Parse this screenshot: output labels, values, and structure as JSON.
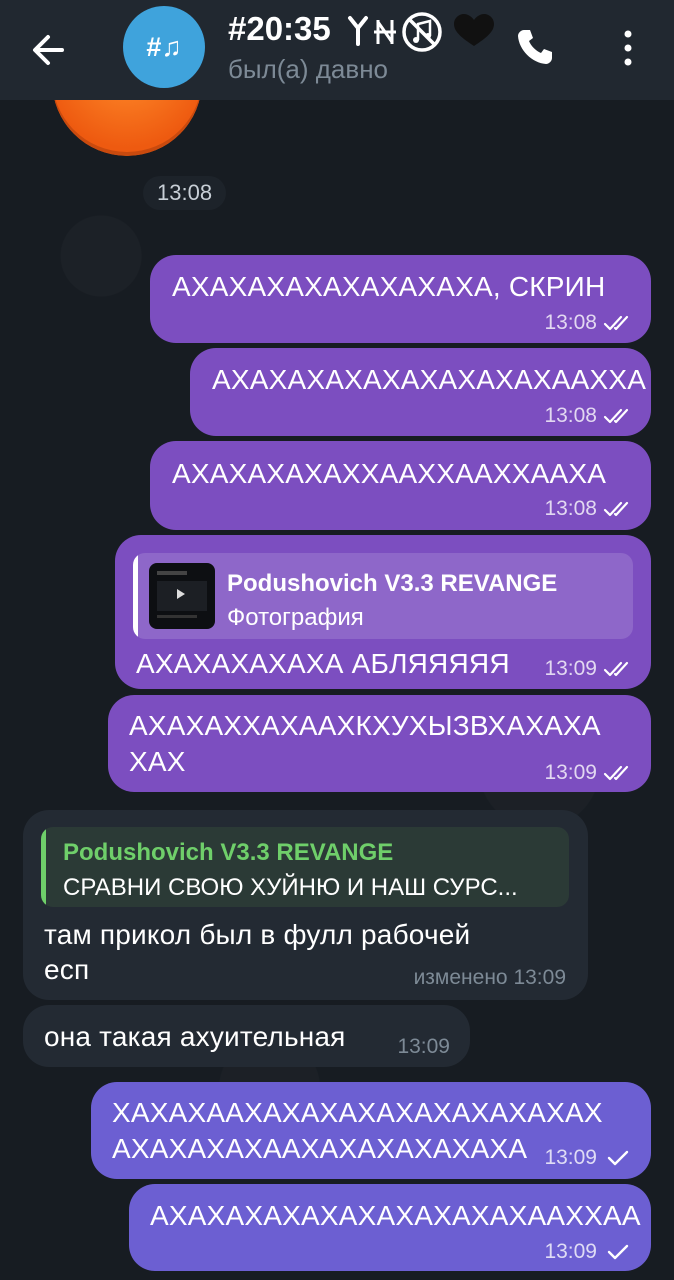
{
  "header": {
    "avatar_text": "#♫",
    "title": "#20:35 ",
    "status": "был(а) давно"
  },
  "chat": {
    "date_pill": "13:08",
    "messages": [
      {
        "text": "АХАХАХАХАХАХАХАХА, СКРИН",
        "time": "13:08"
      },
      {
        "text": "АХАХАХАХАХАХАХАХАХААХХА",
        "time": "13:08"
      },
      {
        "text": "АХАХАХАХАХХААХХААХХААХА",
        "time": "13:08"
      },
      {
        "reply_name": "Podushovich V3.3 REVANGE",
        "reply_text": "Фотография",
        "text": "АХАХАХАХАХА АБЛЯЯЯЯЯ",
        "time": "13:09"
      },
      {
        "line1": "АХАХАХХАХААХКХУХЫЗВХАХАХА",
        "line2": "ХАХ",
        "time": "13:09"
      },
      {
        "reply_name": "Podushovich V3.3 REVANGE",
        "reply_text": "СРАВНИ СВОЮ ХУЙНЮ И НАШ СУРС...",
        "line1": "там прикол был в фулл рабочей",
        "line2": "есп",
        "time": "изменено 13:09"
      },
      {
        "text": "она такая ахуительная",
        "time": "13:09"
      },
      {
        "line1": "ХАХАХААХАХАХАХАХАХАХАХАХАХ",
        "line2": "АХАХАХАХААХАХАХАХАХАХА",
        "time": "13:09"
      },
      {
        "text": "АХАХАХАХАХАХАХАХАХАХААХХАА",
        "time": "13:09"
      }
    ]
  },
  "colors": {
    "header_bg": "#212830",
    "outgoing": "#7c4ec0",
    "outgoing_pending": "#6c5fd2",
    "incoming": "#232a33",
    "reply_name_incoming": "#6fcf6a"
  },
  "icons": {
    "back": "arrow-left-icon",
    "call": "phone-icon",
    "menu": "more-vertical-icon",
    "read": "double-check-icon",
    "sent": "single-check-icon"
  }
}
